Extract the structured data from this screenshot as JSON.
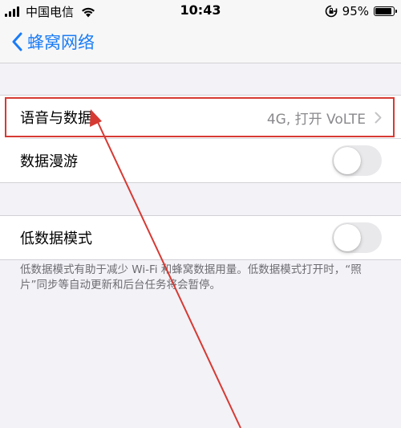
{
  "status_bar": {
    "carrier": "中国电信",
    "time": "10:43",
    "battery_percent": "95%",
    "battery_level": 0.95,
    "icons": [
      "signal-bars-icon",
      "wifi-icon",
      "rotation-lock-icon",
      "battery-icon"
    ]
  },
  "nav": {
    "back_label": "蜂窝网络",
    "back_icon": "chevron-left-icon"
  },
  "rows": {
    "voice_data": {
      "label": "语音与数据",
      "value": "4G, 打开 VoLTE"
    },
    "data_roaming": {
      "label": "数据漫游",
      "on": false
    },
    "low_data_mode": {
      "label": "低数据模式",
      "on": false
    }
  },
  "footer_note": "低数据模式有助于减少 Wi-Fi 和蜂窝数据用量。低数据模式打开时，“照片”同步等自动更新和后台任务将会暂停。",
  "colors": {
    "accent": "#1a7cf6",
    "annotation": "#d63a33",
    "background": "#f2f2f7"
  }
}
